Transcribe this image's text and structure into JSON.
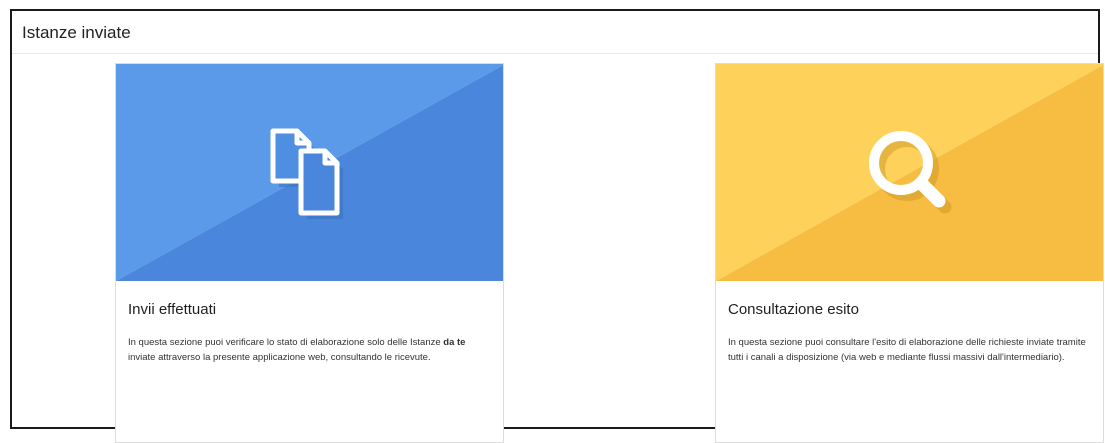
{
  "section": {
    "title": "Istanze inviate"
  },
  "cards": [
    {
      "title": "Invii effettuati",
      "desc_before": "In questa sezione puoi verificare lo stato di elaborazione solo delle Istanze ",
      "desc_bold": "da te",
      "desc_after": " inviate attraverso la presente applicazione web, consultando le ricevute.",
      "icon": "documents-icon",
      "colors": {
        "light": "#5b9ae8",
        "dark": "#4a86db"
      }
    },
    {
      "title": "Consultazione esito",
      "desc": "In questa sezione puoi consultare l'esito di elaborazione delle richieste inviate tramite tutti i canali a disposizione (via web e mediante flussi massivi dall'intermediario).",
      "icon": "search-icon",
      "colors": {
        "light": "#fdd15a",
        "dark": "#f6bd42"
      }
    }
  ]
}
